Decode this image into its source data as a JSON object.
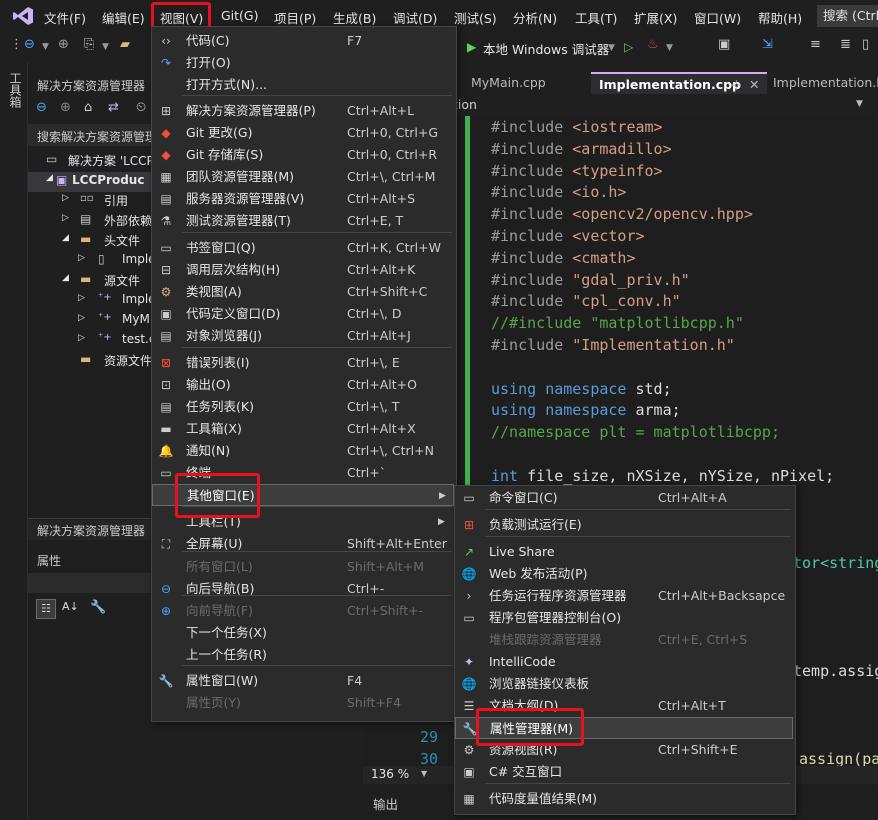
{
  "menubar": {
    "items": [
      "文件(F)",
      "编辑(E)",
      "视图(V)",
      "Git(G)",
      "项目(P)",
      "生成(B)",
      "调试(D)",
      "测试(S)",
      "分析(N)",
      "工具(T)",
      "扩展(X)",
      "窗口(W)",
      "帮助(H)"
    ],
    "search": "搜索 (Ctrl"
  },
  "toolbar": {
    "debug_target": "本地 Windows 调试器"
  },
  "side_strip": {
    "label": "工具箱"
  },
  "solution_explorer": {
    "title": "解决方案资源管理器",
    "search_placeholder": "搜索解决方案资源管理器",
    "tree": [
      "解决方案 'LCCP",
      "LCCProduc",
      "引用",
      "外部依赖",
      "头文件",
      "Imple",
      "源文件",
      "Imple",
      "MyM",
      "test.c",
      "资源文件"
    ],
    "bottom_title": "解决方案资源管理器"
  },
  "properties": {
    "title": "属性"
  },
  "editor": {
    "tabs": [
      "MyMain.cpp",
      "Implementation.cpp",
      "Implementation.h"
    ],
    "nav_fragment": "tion",
    "zoom": "136 %",
    "output_label": "输出",
    "line_numbers": [
      "29",
      "30"
    ],
    "code": [
      "#include <iostream>",
      "#include <armadillo>",
      "#include <typeinfo>",
      "#include <io.h>",
      "#include <opencv2/opencv.hpp>",
      "#include <vector>",
      "#include <cmath>",
      "#include \"gdal_priv.h\"",
      "#include \"cpl_conv.h\"",
      "//#include \"matplotlibcpp.h\"",
      "#include \"Implementation.h\"",
      "",
      "using namespace std;",
      "using namespace arma;",
      "//namespace plt = matplotlibcpp;",
      "",
      "int file_size, nXSize, nYSize, nPixel;"
    ],
    "code_fragments": [
      "tor<string",
      "temp.assig",
      "assign(pa"
    ]
  },
  "view_menu": {
    "items": [
      {
        "label": "代码(C)",
        "shortcut": "F7",
        "icon": "code-icon"
      },
      {
        "label": "打开(O)",
        "shortcut": "",
        "icon": "open-icon"
      },
      {
        "label": "打开方式(N)...",
        "shortcut": "",
        "icon": ""
      },
      {
        "label": "解决方案资源管理器(P)",
        "shortcut": "Ctrl+Alt+L",
        "icon": "solution-explorer-icon"
      },
      {
        "label": "Git 更改(G)",
        "shortcut": "Ctrl+0, Ctrl+G",
        "icon": "git-changes-icon"
      },
      {
        "label": "Git 存储库(S)",
        "shortcut": "Ctrl+0, Ctrl+R",
        "icon": "git-repository-icon"
      },
      {
        "label": "团队资源管理器(M)",
        "shortcut": "Ctrl+\\, Ctrl+M",
        "icon": "team-explorer-icon"
      },
      {
        "label": "服务器资源管理器(V)",
        "shortcut": "Ctrl+Alt+S",
        "icon": "server-explorer-icon"
      },
      {
        "label": "测试资源管理器(T)",
        "shortcut": "Ctrl+E, T",
        "icon": "test-explorer-icon"
      },
      {
        "label": "书签窗口(Q)",
        "shortcut": "Ctrl+K, Ctrl+W",
        "icon": "bookmark-icon"
      },
      {
        "label": "调用层次结构(H)",
        "shortcut": "Ctrl+Alt+K",
        "icon": "call-hierarchy-icon"
      },
      {
        "label": "类视图(A)",
        "shortcut": "Ctrl+Shift+C",
        "icon": "class-view-icon"
      },
      {
        "label": "代码定义窗口(D)",
        "shortcut": "Ctrl+\\, D",
        "icon": "code-definition-icon"
      },
      {
        "label": "对象浏览器(J)",
        "shortcut": "Ctrl+Alt+J",
        "icon": "object-browser-icon"
      },
      {
        "label": "错误列表(I)",
        "shortcut": "Ctrl+\\, E",
        "icon": "error-list-icon"
      },
      {
        "label": "输出(O)",
        "shortcut": "Ctrl+Alt+O",
        "icon": "output-icon"
      },
      {
        "label": "任务列表(K)",
        "shortcut": "Ctrl+\\, T",
        "icon": "task-list-icon"
      },
      {
        "label": "工具箱(X)",
        "shortcut": "Ctrl+Alt+X",
        "icon": "toolbox-icon"
      },
      {
        "label": "通知(N)",
        "shortcut": "Ctrl+\\, Ctrl+N",
        "icon": "notification-icon"
      },
      {
        "label": "终端",
        "shortcut": "Ctrl+`",
        "icon": "terminal-icon"
      },
      {
        "label": "其他窗口(E)",
        "shortcut": "",
        "icon": ""
      },
      {
        "label": "工具栏(T)",
        "shortcut": "",
        "icon": ""
      },
      {
        "label": "全屏幕(U)",
        "shortcut": "Shift+Alt+Enter",
        "icon": "fullscreen-icon"
      },
      {
        "label": "所有窗口(L)",
        "shortcut": "Shift+Alt+M",
        "icon": ""
      },
      {
        "label": "向后导航(B)",
        "shortcut": "Ctrl+-",
        "icon": "navigate-back-icon"
      },
      {
        "label": "向前导航(F)",
        "shortcut": "Ctrl+Shift+-",
        "icon": "navigate-forward-icon"
      },
      {
        "label": "下一个任务(X)",
        "shortcut": "",
        "icon": ""
      },
      {
        "label": "上一个任务(R)",
        "shortcut": "",
        "icon": ""
      },
      {
        "label": "属性窗口(W)",
        "shortcut": "F4",
        "icon": "wrench-icon"
      },
      {
        "label": "属性页(Y)",
        "shortcut": "Shift+F4",
        "icon": ""
      }
    ]
  },
  "other_windows_menu": {
    "items": [
      {
        "label": "命令窗口(C)",
        "shortcut": "Ctrl+Alt+A",
        "icon": "command-window-icon"
      },
      {
        "label": "负载测试运行(E)",
        "shortcut": "",
        "icon": "load-test-icon"
      },
      {
        "label": "Live Share",
        "shortcut": "",
        "icon": "live-share-icon"
      },
      {
        "label": "Web 发布活动(P)",
        "shortcut": "",
        "icon": "web-publish-icon"
      },
      {
        "label": "任务运行程序资源管理器",
        "shortcut": "Ctrl+Alt+Backsapce",
        "icon": "task-runner-icon"
      },
      {
        "label": "程序包管理器控制台(O)",
        "shortcut": "",
        "icon": "package-console-icon"
      },
      {
        "label": "堆栈跟踪资源管理器",
        "shortcut": "Ctrl+E, Ctrl+S",
        "icon": ""
      },
      {
        "label": "IntelliCode",
        "shortcut": "",
        "icon": "intellicode-icon"
      },
      {
        "label": "浏览器链接仪表板",
        "shortcut": "",
        "icon": "browser-link-icon"
      },
      {
        "label": "文档大纲(D)",
        "shortcut": "Ctrl+Alt+T",
        "icon": "document-outline-icon"
      },
      {
        "label": "属性管理器(M)",
        "shortcut": "",
        "icon": "property-manager-icon"
      },
      {
        "label": "资源视图(R)",
        "shortcut": "Ctrl+Shift+E",
        "icon": "resource-view-icon"
      },
      {
        "label": "C# 交互窗口",
        "shortcut": "",
        "icon": "csharp-interactive-icon"
      },
      {
        "label": "代码度量值结果(M)",
        "shortcut": "",
        "icon": "code-metrics-icon"
      }
    ]
  }
}
